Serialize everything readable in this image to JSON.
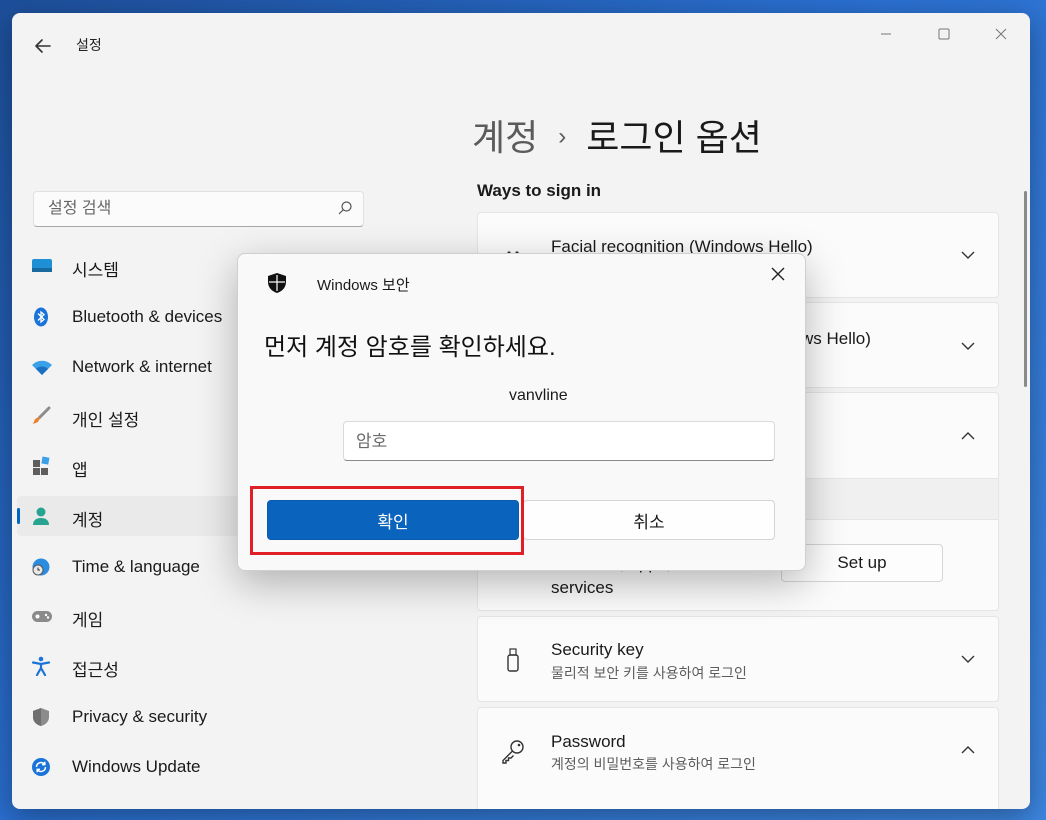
{
  "app": {
    "title": "설정"
  },
  "breadcrumb": {
    "parent": "계정",
    "separator": "›",
    "current": "로그인 옵션"
  },
  "search": {
    "placeholder": "설정 검색"
  },
  "sidebar": {
    "items": [
      {
        "label": "시스템",
        "icon": "monitor-icon",
        "active": false
      },
      {
        "label": "Bluetooth & devices",
        "icon": "bluetooth-icon",
        "active": false
      },
      {
        "label": "Network & internet",
        "icon": "wifi-icon",
        "active": false
      },
      {
        "label": "개인 설정",
        "icon": "brush-icon",
        "active": false
      },
      {
        "label": "앱",
        "icon": "apps-icon",
        "active": false
      },
      {
        "label": "계정",
        "icon": "person-icon",
        "active": true
      },
      {
        "label": "Time & language",
        "icon": "globe-clock-icon",
        "active": false
      },
      {
        "label": "게임",
        "icon": "gamepad-icon",
        "active": false
      },
      {
        "label": "접근성",
        "icon": "accessibility-icon",
        "active": false
      },
      {
        "label": "Privacy & security",
        "icon": "shield-icon",
        "active": false
      },
      {
        "label": "Windows Update",
        "icon": "update-icon",
        "active": false
      }
    ]
  },
  "main": {
    "section_title": "Ways to sign in",
    "cards": [
      {
        "title": "Facial recognition (Windows Hello)"
      },
      {
        "title": "ws Hello)"
      },
      {
        "title": "Windows, apps, and",
        "subtitle": "services",
        "button": "Set up"
      },
      {
        "title": "Security key",
        "subtitle": "물리적 보안 키를 사용하여 로그인"
      },
      {
        "title": "Password",
        "subtitle": "계정의 비밀번호를 사용하여 로그인"
      }
    ]
  },
  "dialog": {
    "app_name": "Windows 보안",
    "heading": "먼저 계정 암호를 확인하세요.",
    "username": "vanvline",
    "password_placeholder": "암호",
    "ok_label": "확인",
    "cancel_label": "취소"
  },
  "colors": {
    "accent": "#0a63bd",
    "highlight": "#e01f26"
  }
}
